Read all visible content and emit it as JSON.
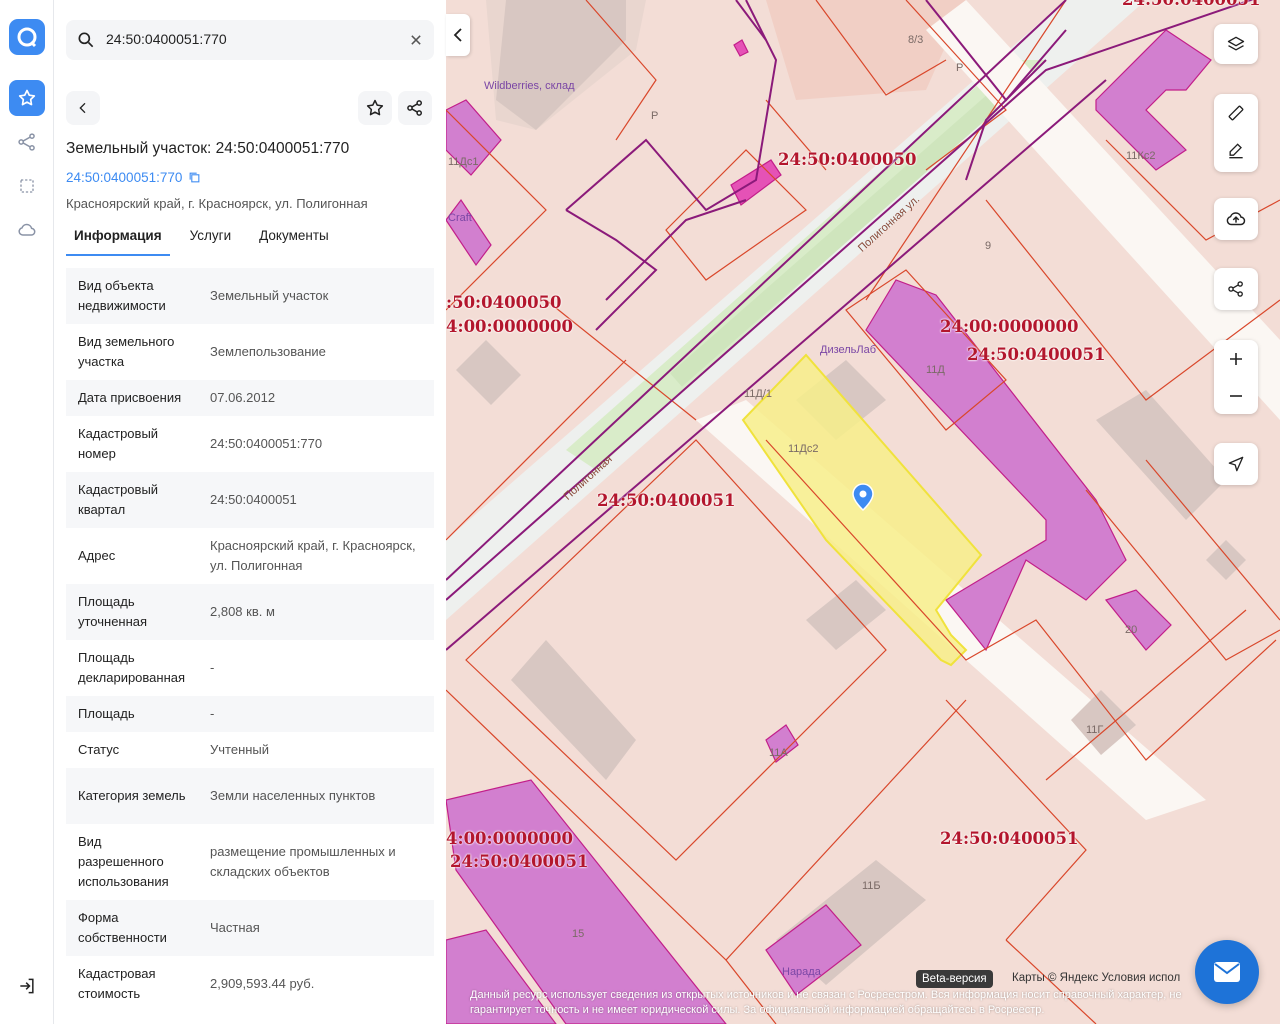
{
  "search": {
    "value": "24:50:0400051:770"
  },
  "card": {
    "title": "Земельный участок: 24:50:0400051:770",
    "cadastral_link": "24:50:0400051:770",
    "address": "Красноярский край, г. Красноярск, ул. Полигонная"
  },
  "tabs": [
    {
      "label": "Информация",
      "active": true
    },
    {
      "label": "Услуги"
    },
    {
      "label": "Документы"
    }
  ],
  "rows": [
    {
      "key": "Вид объекта недвижимости",
      "value": "Земельный участок"
    },
    {
      "key": "Вид земельного участка",
      "value": "Землепользование"
    },
    {
      "key": "Дата присвоения",
      "value": "07.06.2012"
    },
    {
      "key": "Кадастровый номер",
      "value": "24:50:0400051:770"
    },
    {
      "key": "Кадастровый квартал",
      "value": "24:50:0400051"
    },
    {
      "key": "Адрес",
      "value": "Красноярский край, г. Красноярск, ул. Полигонная"
    },
    {
      "key": "Площадь уточненная",
      "value": "2,808 кв. м"
    },
    {
      "key": "Площадь декларированная",
      "value": "-"
    },
    {
      "key": "Площадь",
      "value": "-"
    },
    {
      "key": "Статус",
      "value": "Учтенный"
    },
    {
      "key": "Категория земель",
      "value": "Земли населенных пунктов"
    },
    {
      "key": "Вид разрешенного использования",
      "value": "размещение промышленных и складских объектов"
    },
    {
      "key": "Форма собственности",
      "value": "Частная"
    },
    {
      "key": "Кадастровая стоимость",
      "value": "2,909,593.44 руб."
    }
  ],
  "map": {
    "cadastral_labels": [
      "24:50:0400051",
      "24:50:0400050",
      ":50:0400050",
      "4:00:0000000",
      "24:00:0000000",
      "24:50:0400051",
      "24:50:0400051",
      "4:00:0000000",
      "24:50:0400051",
      "24:50:0400051"
    ],
    "building_numbers": [
      "8/3",
      "Р",
      "Р",
      "11Кс2",
      "9",
      "11Дс1",
      "11Д",
      "11Д/1",
      "11Дс2",
      "20",
      "11Г",
      "11А",
      "11Б",
      "15"
    ],
    "pois": [
      "Wildberries, склад",
      "ДизельЛаб",
      "Craft",
      "Нарада"
    ],
    "streets": [
      "Полигонная ул.",
      "Полигонная"
    ],
    "beta": "Beta-версия",
    "attribution": "Карты © Яндекс   Условия испол",
    "disclaimer": "Данный ресурс использует сведения из открытых источников и не связан с Росреестром. Вся информация носит справочный характер, не гарантирует точность и не имеет юридической силы. За официальной информацией обращайтесь в Росреестр."
  },
  "colors": {
    "accent": "#3d8bf2",
    "parcel_border": "#d9472b",
    "building": "#d27fcf",
    "selected": "#f7ee8a",
    "label": "#b3162d"
  }
}
